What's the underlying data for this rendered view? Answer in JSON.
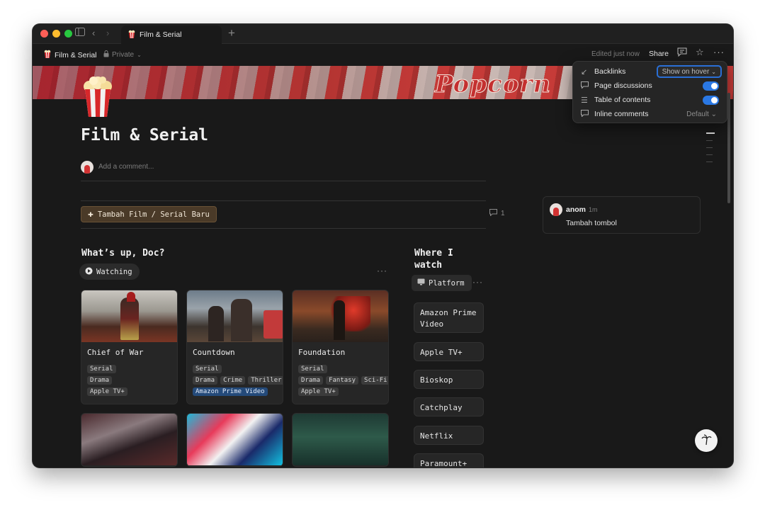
{
  "colors": {
    "accent": "#2a78e4",
    "button_bg": "#4a3a28",
    "tag_blue": "#244a7a",
    "window_bg": "#191919"
  },
  "browser": {
    "tab_title": "Film & Serial",
    "tab_icon": "popcorn-icon"
  },
  "topnav": {
    "page_name": "Film & Serial",
    "privacy": "Private",
    "edited": "Edited just now",
    "share": "Share"
  },
  "cover": {
    "text": "Popcorn"
  },
  "page": {
    "title": "Film & Serial",
    "comment_placeholder": "Add a comment...",
    "add_button": "Tambah Film / Serial Baru",
    "comment_count": "1"
  },
  "comment": {
    "user": "anom",
    "time": "1m",
    "text": "Tambah tombol"
  },
  "popover": {
    "backlinks": "Backlinks",
    "backlinks_value": "Show on hover",
    "page_discussions": "Page discussions",
    "page_discussions_on": true,
    "toc": "Table of contents",
    "toc_on": true,
    "inline_comments": "Inline comments",
    "inline_comments_value": "Default"
  },
  "watching": {
    "title": "What’s up, Doc?",
    "view": "Watching",
    "cards": [
      {
        "title": "Chief of War",
        "tags": [
          "Serial"
        ],
        "genres": [
          "Drama"
        ],
        "platforms": [
          "Apple TV+"
        ]
      },
      {
        "title": "Countdown",
        "tags": [
          "Serial"
        ],
        "genres": [
          "Drama",
          "Crime",
          "Thriller"
        ],
        "platforms": [
          "Amazon Prime Video"
        ]
      },
      {
        "title": "Foundation",
        "tags": [
          "Serial"
        ],
        "genres": [
          "Drama",
          "Fantasy",
          "Sci-Fi"
        ],
        "platforms": [
          "Apple TV+"
        ]
      }
    ]
  },
  "platforms": {
    "title": "Where I watch",
    "view": "Platform",
    "items": [
      "Amazon Prime Video",
      "Apple TV+",
      "Bioskop",
      "Catchplay",
      "Netflix",
      "Paramount+"
    ]
  }
}
